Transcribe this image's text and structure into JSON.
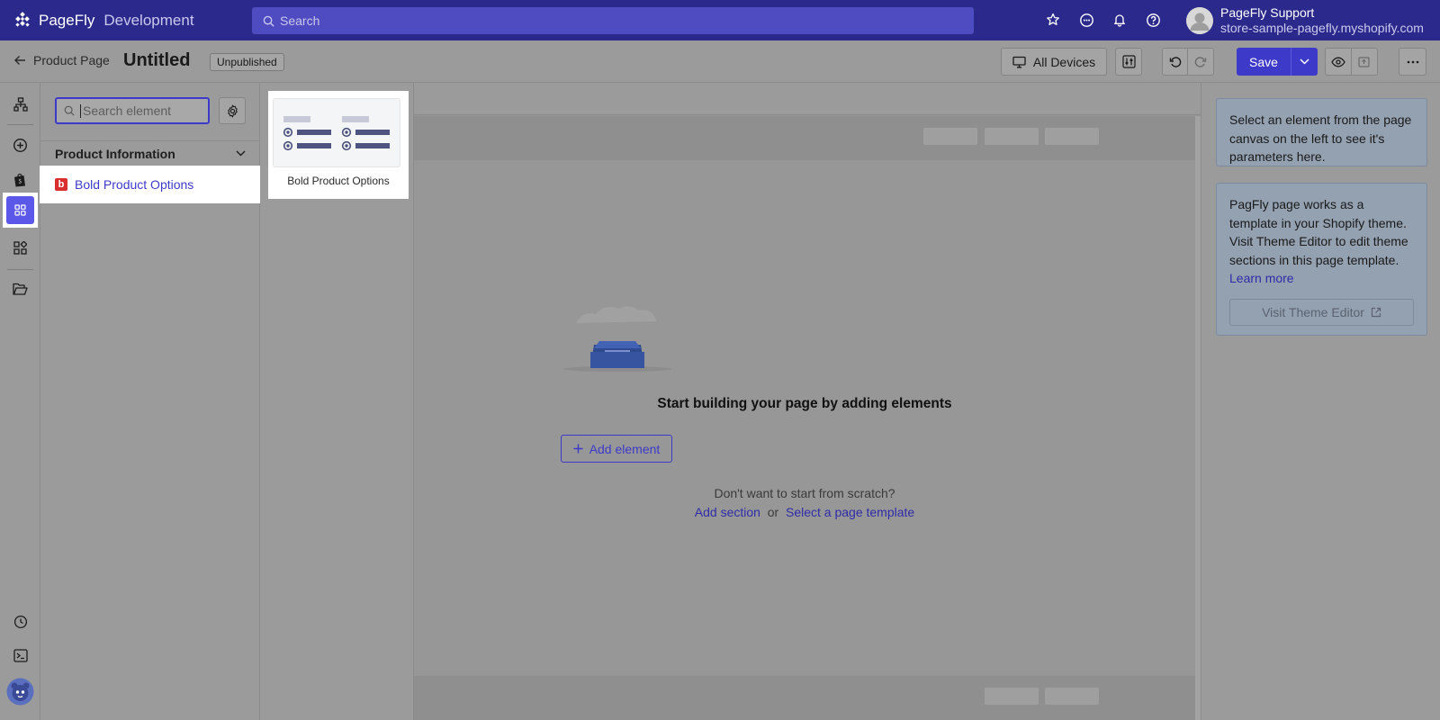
{
  "app": {
    "brand_name": "PageFly",
    "environment": "Development",
    "search_placeholder": "Search",
    "user_name": "PageFly Support",
    "store_url": "store-sample-pagefly.myshopify.com"
  },
  "toolbar": {
    "back_label": "Product Page",
    "page_title": "Untitled",
    "status": "Unpublished",
    "devices_label": "All Devices",
    "save_label": "Save"
  },
  "panel": {
    "search_placeholder": "Search element",
    "section_title": "Product Information",
    "items": [
      {
        "icon": "b",
        "label": "Bold Product Options"
      }
    ]
  },
  "preview": {
    "label": "Bold Product Options"
  },
  "canvas": {
    "empty_title": "Start building your page by adding elements",
    "add_element_label": "Add element",
    "scratch_text": "Don't want to start from scratch?",
    "add_section_label": "Add section",
    "or_text": "or",
    "template_link_label": "Select a page template"
  },
  "right_panel": {
    "hint_text": "Select an element from the page canvas on the left to see it's parameters here.",
    "theme_text": "PagFly page works as a template in your Shopify theme. Visit Theme Editor to edit theme sections in this page template.",
    "learn_more_label": "Learn more",
    "theme_editor_label": "Visit Theme Editor"
  },
  "colors": {
    "brand_bar": "#2b2a8c",
    "accent": "#3d3ac9",
    "active_rail": "#5b57e8"
  }
}
